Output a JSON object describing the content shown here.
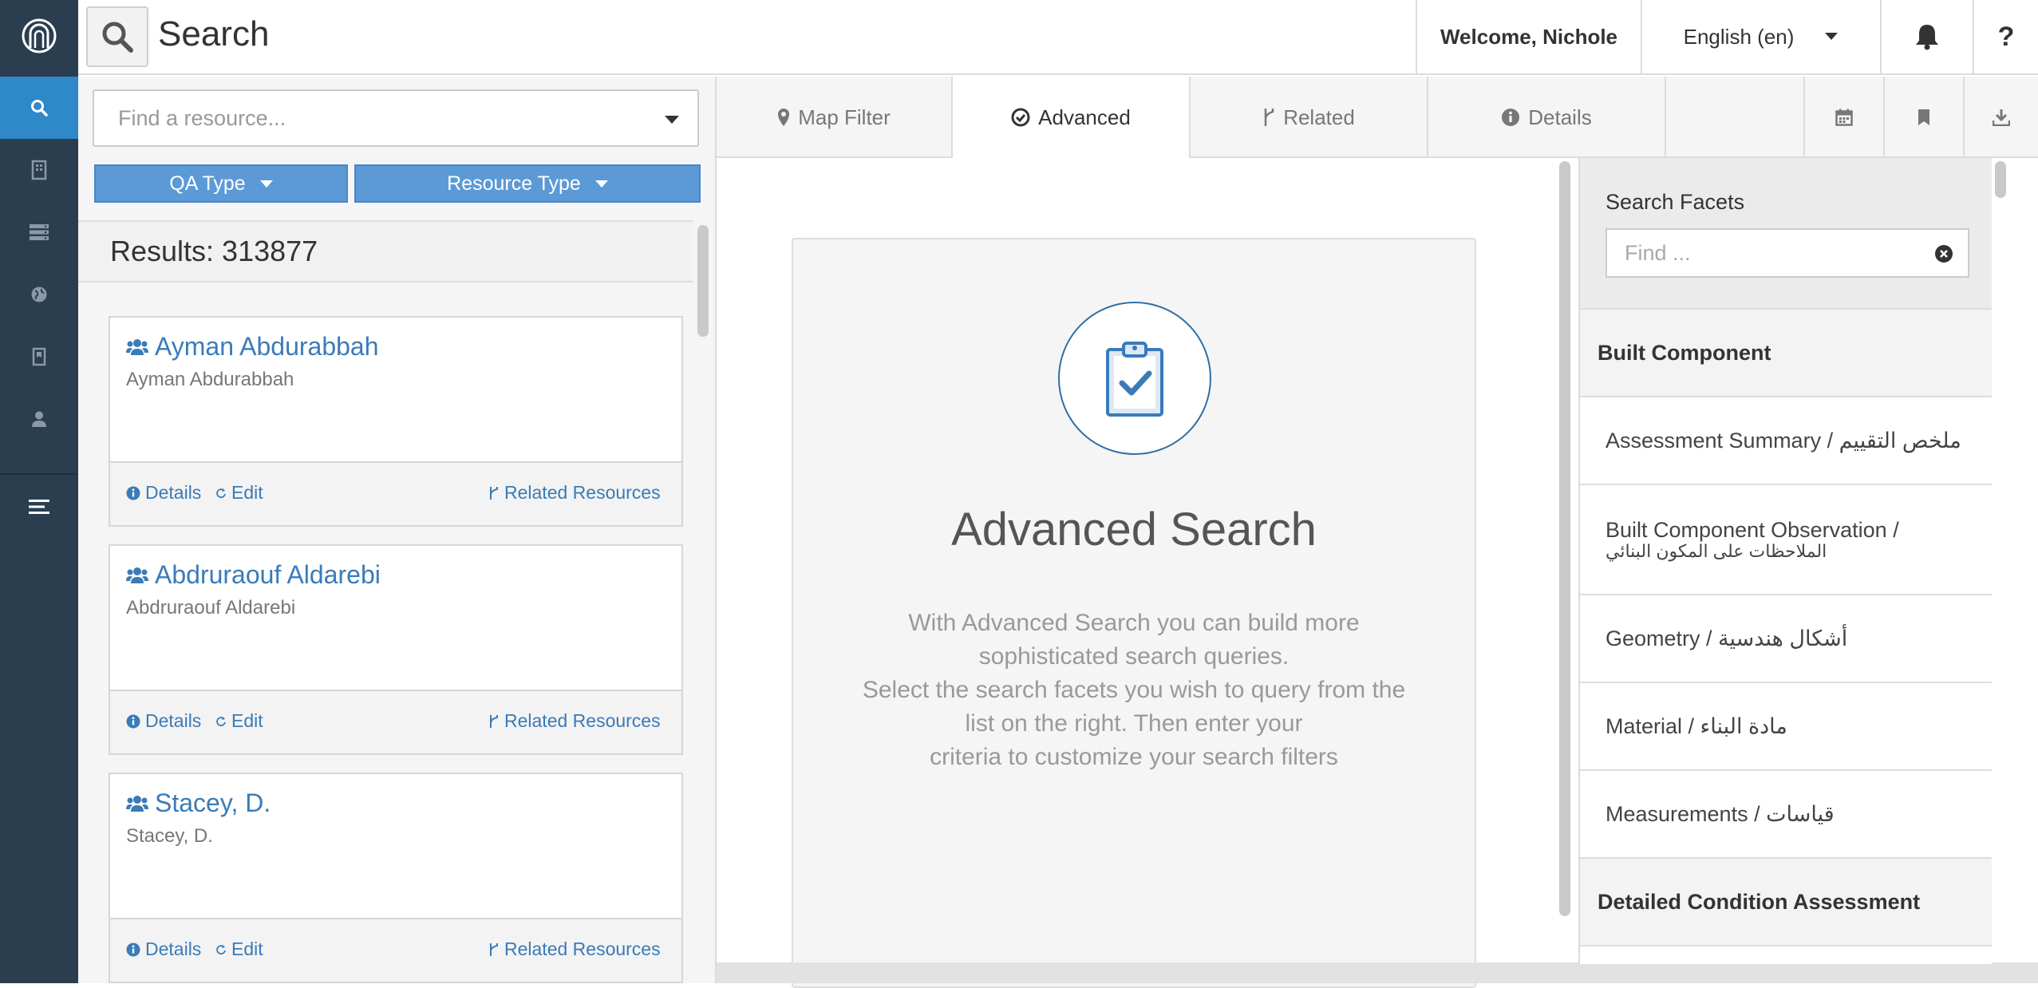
{
  "topbar": {
    "title": "Search",
    "welcome": "Welcome, Nichole",
    "language": "English (en)"
  },
  "search": {
    "placeholder": "Find a resource...",
    "filters": [
      "QA Type",
      "Resource Type"
    ],
    "results_label": "Results: 313877"
  },
  "results": [
    {
      "name": "Ayman Abdurabbah",
      "subtitle": "Ayman Abdurabbah",
      "details": "Details",
      "edit": "Edit",
      "related": "Related Resources"
    },
    {
      "name": "Abdruraouf Aldarebi",
      "subtitle": "Abdruraouf Aldarebi",
      "details": "Details",
      "edit": "Edit",
      "related": "Related Resources"
    },
    {
      "name": "Stacey, D.",
      "subtitle": "Stacey, D.",
      "details": "Details",
      "edit": "Edit",
      "related": "Related Resources"
    }
  ],
  "tabs": [
    "Map Filter",
    "Advanced",
    "Related",
    "Details"
  ],
  "advanced": {
    "title": "Advanced Search",
    "desc_lines": [
      "With Advanced Search you can build more",
      "sophisticated search queries.",
      "Select the search facets you wish to query from the",
      "list on the right. Then enter your",
      "criteria to customize your search filters"
    ]
  },
  "facets": {
    "title": "Search Facets",
    "find_placeholder": "Find ...",
    "groups": [
      "Built Component",
      "Detailed Condition Assessment"
    ],
    "items": [
      {
        "line1": "Assessment Summary / ملخص التقييم",
        "line2": ""
      },
      {
        "line1": "Built Component Observation /",
        "line2": "الملاحظات على المكون البنائي"
      },
      {
        "line1": "Geometry / أشكال هندسية",
        "line2": ""
      },
      {
        "line1": "Material / مادة البناء",
        "line2": ""
      },
      {
        "line1": "Measurements / قياسات",
        "line2": ""
      }
    ]
  },
  "colors": {
    "sidebar": "#2b3e50",
    "sidebar_active": "#2f89c8",
    "accent": "#3a7bb8",
    "filter_button": "#5b9ad6"
  },
  "icons": {
    "sidebar": [
      "search-icon",
      "building-icon",
      "server-icon",
      "globe-icon",
      "bookmark-file-icon",
      "user-icon",
      "list-icon"
    ],
    "toolbar": [
      "calendar-icon",
      "bookmark-icon",
      "download-icon"
    ]
  }
}
